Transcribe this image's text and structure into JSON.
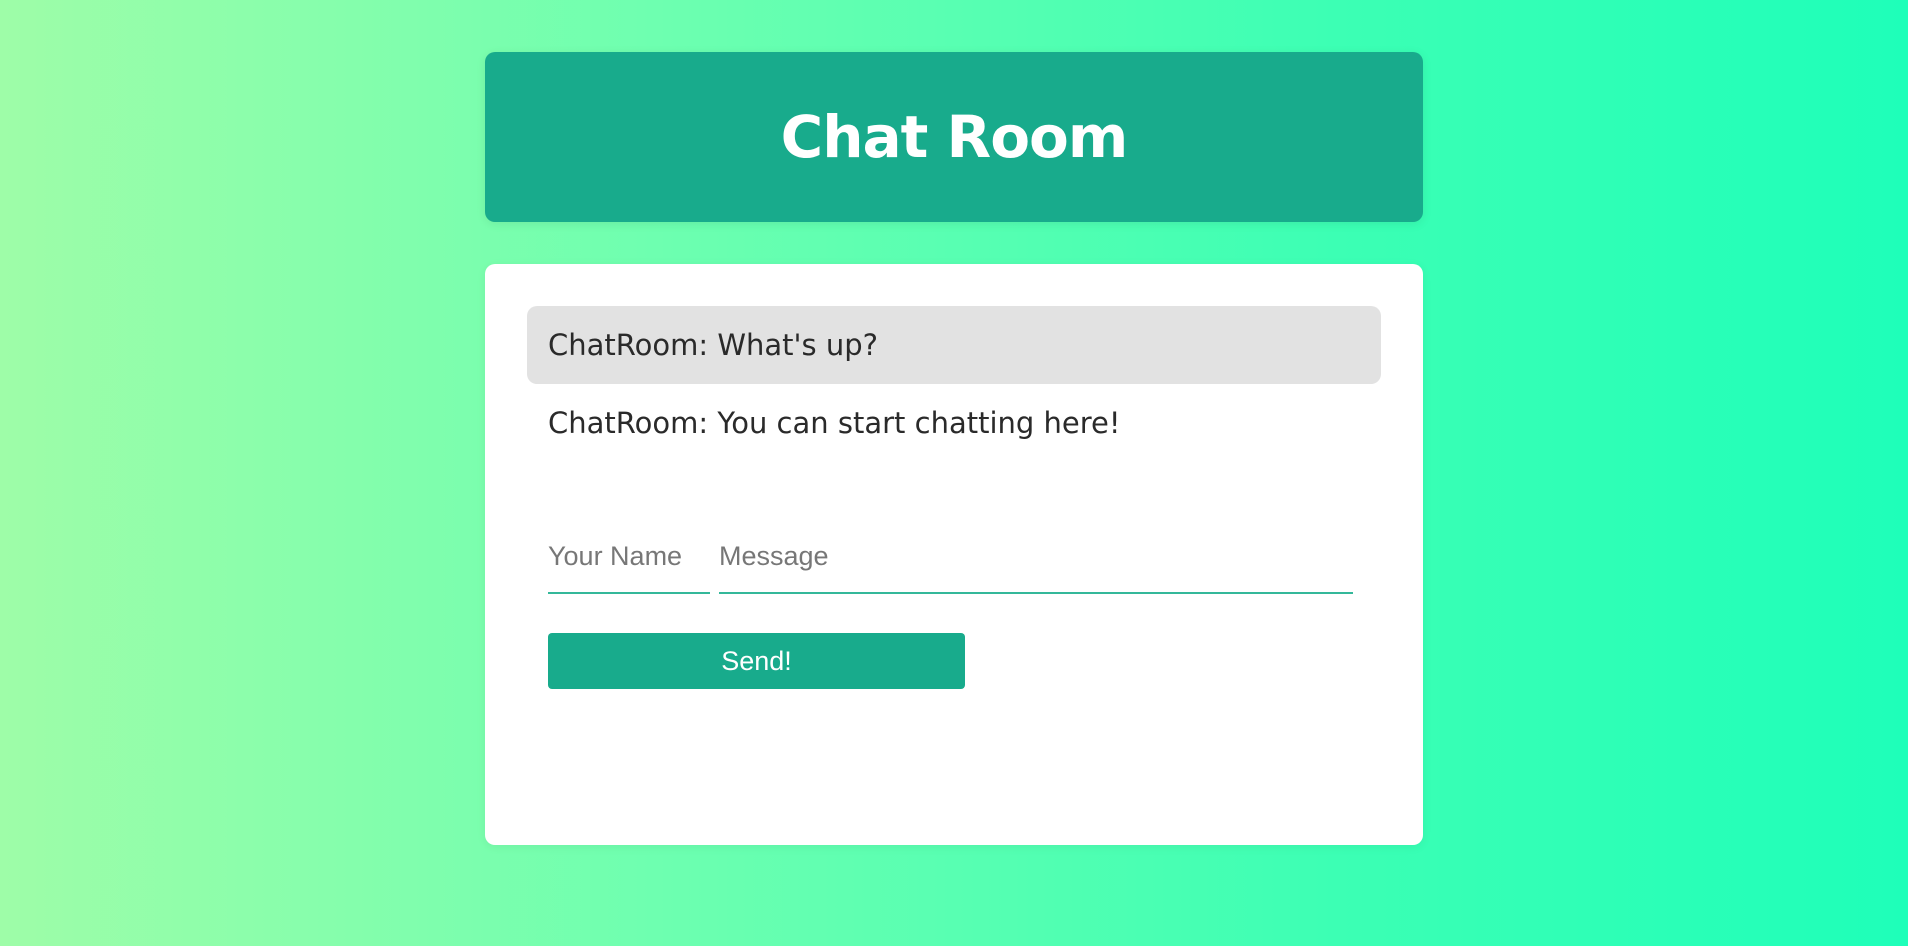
{
  "header": {
    "title": "Chat Room"
  },
  "messages": [
    {
      "text": "ChatRoom: What's up?",
      "highlighted": true
    },
    {
      "text": "ChatRoom: You can start chatting here!",
      "highlighted": false
    }
  ],
  "form": {
    "name_placeholder": "Your Name",
    "name_value": "",
    "message_placeholder": "Message",
    "message_value": "",
    "send_label": "Send!"
  },
  "colors": {
    "accent": "#18ab8c",
    "background_start": "#9efda8",
    "background_end": "#1effb9",
    "highlight_message": "#e2e2e2"
  }
}
